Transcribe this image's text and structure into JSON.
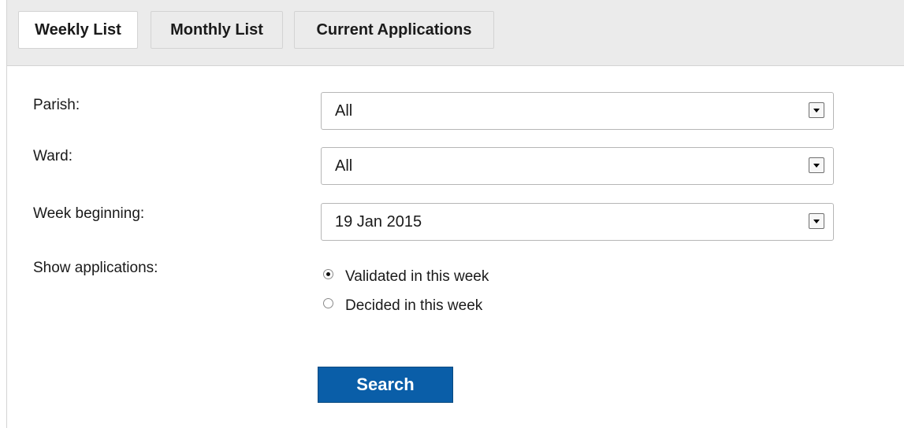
{
  "tabs": [
    {
      "label": "Weekly List",
      "active": true
    },
    {
      "label": "Monthly List",
      "active": false
    },
    {
      "label": "Current Applications",
      "active": false
    }
  ],
  "form": {
    "parish": {
      "label": "Parish:",
      "value": "All"
    },
    "ward": {
      "label": "Ward:",
      "value": "All"
    },
    "week_beginning": {
      "label": "Week beginning:",
      "value": "19 Jan 2015"
    },
    "show_applications": {
      "label": "Show applications:",
      "options": [
        {
          "label": "Validated in this week",
          "checked": true
        },
        {
          "label": "Decided in this week",
          "checked": false
        }
      ]
    },
    "search_label": "Search"
  },
  "colors": {
    "search_button": "#0a5ea8",
    "tab_bar": "#ebebeb"
  }
}
